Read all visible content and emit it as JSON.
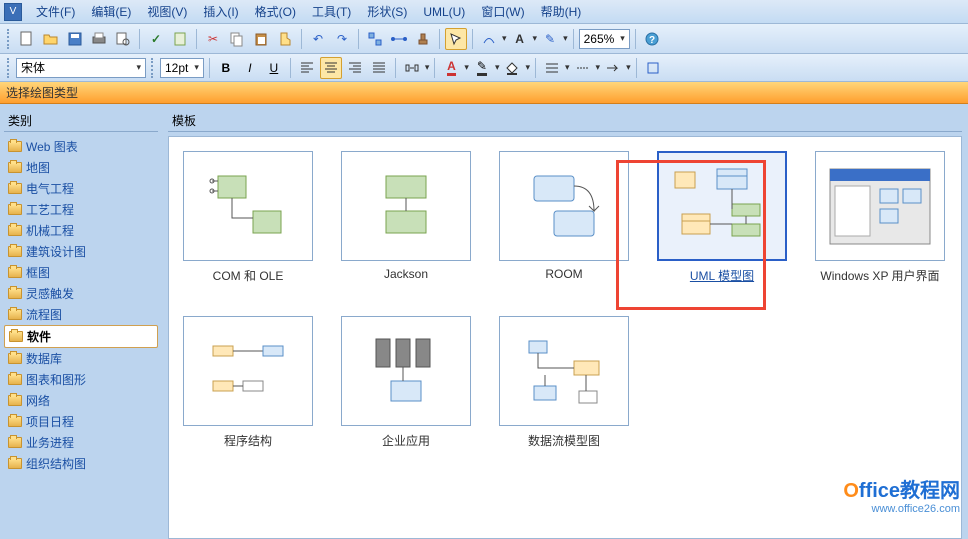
{
  "menus": [
    "文件(F)",
    "编辑(E)",
    "视图(V)",
    "插入(I)",
    "格式(O)",
    "工具(T)",
    "形状(S)",
    "UML(U)",
    "窗口(W)",
    "帮助(H)"
  ],
  "zoom": "265%",
  "font_name": "宋体",
  "font_size": "12pt",
  "orange_header": "选择绘图类型",
  "sidebar_header": "类别",
  "templates_header": "模板",
  "categories": [
    {
      "label": "Web 图表"
    },
    {
      "label": "地图"
    },
    {
      "label": "电气工程"
    },
    {
      "label": "工艺工程"
    },
    {
      "label": "机械工程"
    },
    {
      "label": "建筑设计图"
    },
    {
      "label": "框图"
    },
    {
      "label": "灵感触发"
    },
    {
      "label": "流程图"
    },
    {
      "label": "软件",
      "selected": true
    },
    {
      "label": "数据库"
    },
    {
      "label": "图表和图形"
    },
    {
      "label": "网络"
    },
    {
      "label": "项目日程"
    },
    {
      "label": "业务进程"
    },
    {
      "label": "组织结构图"
    }
  ],
  "templates_row1": [
    {
      "label": "COM 和 OLE"
    },
    {
      "label": "Jackson"
    },
    {
      "label": "ROOM"
    },
    {
      "label": "UML 模型图",
      "selected": true
    },
    {
      "label": "Windows XP 用户界面"
    }
  ],
  "templates_row2": [
    {
      "label": "程序结构"
    },
    {
      "label": "企业应用"
    },
    {
      "label": "数据流模型图"
    }
  ],
  "watermark_main": "Office教程网",
  "watermark_sub": "www.office26.com",
  "icons": {
    "new": "new-icon",
    "open": "open-icon",
    "save": "save-icon",
    "print": "print-icon",
    "bold": "B",
    "italic": "I",
    "underline": "U"
  }
}
